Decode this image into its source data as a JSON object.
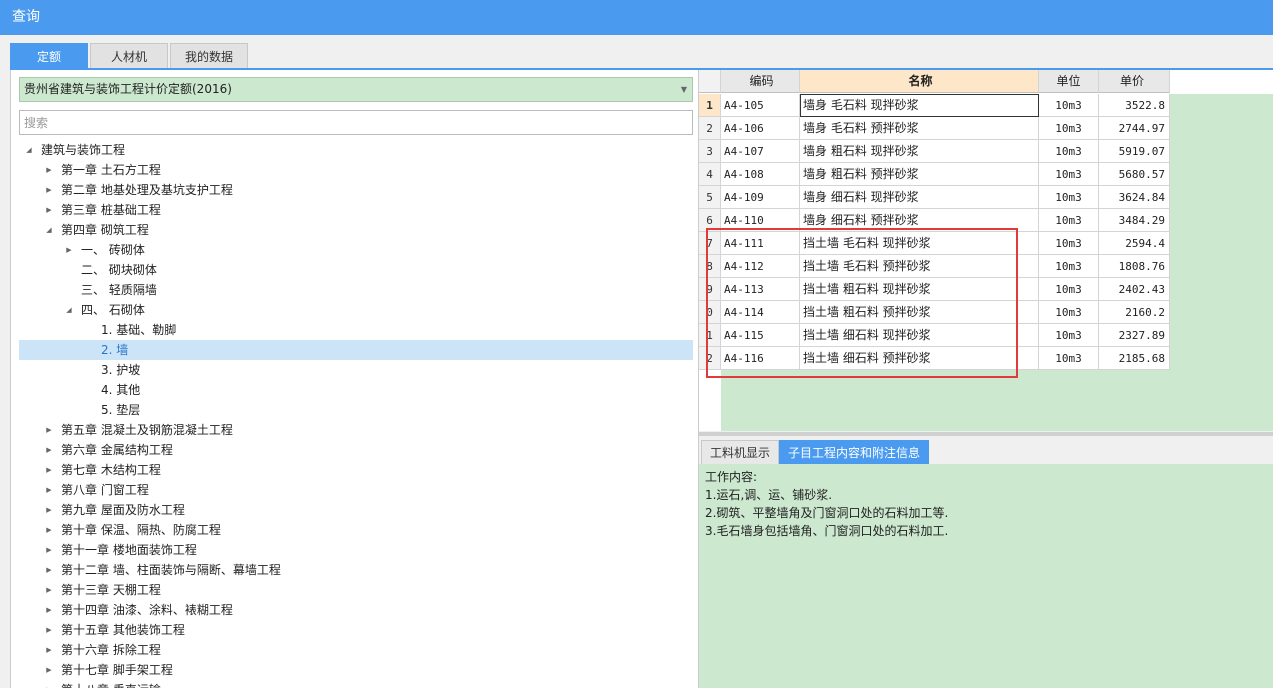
{
  "window": {
    "title": "查询"
  },
  "tabs": [
    {
      "label": "定额",
      "active": true
    },
    {
      "label": "人材机",
      "active": false
    },
    {
      "label": "我的数据",
      "active": false
    }
  ],
  "left": {
    "quota_select": "贵州省建筑与装饰工程计价定额(2016)",
    "search_placeholder": "搜索",
    "tree": [
      {
        "label": "建筑与装饰工程",
        "level": 0,
        "state": "expanded"
      },
      {
        "label": "第一章 土石方工程",
        "level": 1,
        "state": "collapsed"
      },
      {
        "label": "第二章 地基处理及基坑支护工程",
        "level": 1,
        "state": "collapsed"
      },
      {
        "label": "第三章 桩基础工程",
        "level": 1,
        "state": "collapsed"
      },
      {
        "label": "第四章 砌筑工程",
        "level": 1,
        "state": "expanded"
      },
      {
        "label": "一、 砖砌体",
        "level": 2,
        "state": "collapsed"
      },
      {
        "label": "二、 砌块砌体",
        "level": 2,
        "state": "leaf"
      },
      {
        "label": "三、 轻质隔墙",
        "level": 2,
        "state": "leaf"
      },
      {
        "label": "四、 石砌体",
        "level": 2,
        "state": "expanded"
      },
      {
        "label": "1. 基础、勒脚",
        "level": 3,
        "state": "leaf"
      },
      {
        "label": "2. 墙",
        "level": 3,
        "state": "leaf",
        "selected": true
      },
      {
        "label": "3. 护坡",
        "level": 3,
        "state": "leaf"
      },
      {
        "label": "4. 其他",
        "level": 3,
        "state": "leaf"
      },
      {
        "label": "5. 垫层",
        "level": 3,
        "state": "leaf"
      },
      {
        "label": "第五章 混凝土及钢筋混凝土工程",
        "level": 1,
        "state": "collapsed"
      },
      {
        "label": "第六章 金属结构工程",
        "level": 1,
        "state": "collapsed"
      },
      {
        "label": "第七章 木结构工程",
        "level": 1,
        "state": "collapsed"
      },
      {
        "label": "第八章 门窗工程",
        "level": 1,
        "state": "collapsed"
      },
      {
        "label": "第九章 屋面及防水工程",
        "level": 1,
        "state": "collapsed"
      },
      {
        "label": "第十章 保温、隔热、防腐工程",
        "level": 1,
        "state": "collapsed"
      },
      {
        "label": "第十一章 楼地面装饰工程",
        "level": 1,
        "state": "collapsed"
      },
      {
        "label": "第十二章 墙、柱面装饰与隔断、幕墙工程",
        "level": 1,
        "state": "collapsed"
      },
      {
        "label": "第十三章 天棚工程",
        "level": 1,
        "state": "collapsed"
      },
      {
        "label": "第十四章 油漆、涂料、裱糊工程",
        "level": 1,
        "state": "collapsed"
      },
      {
        "label": "第十五章 其他装饰工程",
        "level": 1,
        "state": "collapsed"
      },
      {
        "label": "第十六章 拆除工程",
        "level": 1,
        "state": "collapsed"
      },
      {
        "label": "第十七章 脚手架工程",
        "level": 1,
        "state": "collapsed"
      },
      {
        "label": "第十八章 垂直运输",
        "level": 1,
        "state": "collapsed"
      }
    ]
  },
  "grid": {
    "columns": [
      "编码",
      "名称",
      "单位",
      "单价"
    ],
    "rows": [
      {
        "idx": "1",
        "code": "A4-105",
        "name": "墙身 毛石料 现拌砂浆",
        "unit": "10m3",
        "price": "3522.8"
      },
      {
        "idx": "2",
        "code": "A4-106",
        "name": "墙身 毛石料 预拌砂浆",
        "unit": "10m3",
        "price": "2744.97"
      },
      {
        "idx": "3",
        "code": "A4-107",
        "name": "墙身 粗石料 现拌砂浆",
        "unit": "10m3",
        "price": "5919.07"
      },
      {
        "idx": "4",
        "code": "A4-108",
        "name": "墙身 粗石料 预拌砂浆",
        "unit": "10m3",
        "price": "5680.57"
      },
      {
        "idx": "5",
        "code": "A4-109",
        "name": "墙身 细石料 现拌砂浆",
        "unit": "10m3",
        "price": "3624.84"
      },
      {
        "idx": "6",
        "code": "A4-110",
        "name": "墙身 细石料 预拌砂浆",
        "unit": "10m3",
        "price": "3484.29"
      },
      {
        "idx": "7",
        "code": "A4-111",
        "name": "挡土墙 毛石料 现拌砂浆",
        "unit": "10m3",
        "price": "2594.4"
      },
      {
        "idx": "8",
        "code": "A4-112",
        "name": "挡土墙 毛石料 预拌砂浆",
        "unit": "10m3",
        "price": "1808.76"
      },
      {
        "idx": "9",
        "code": "A4-113",
        "name": "挡土墙 粗石料 现拌砂浆",
        "unit": "10m3",
        "price": "2402.43"
      },
      {
        "idx": "0",
        "code": "A4-114",
        "name": "挡土墙 粗石料 预拌砂浆",
        "unit": "10m3",
        "price": "2160.2"
      },
      {
        "idx": "1",
        "code": "A4-115",
        "name": "挡土墙 细石料 现拌砂浆",
        "unit": "10m3",
        "price": "2327.89"
      },
      {
        "idx": "2",
        "code": "A4-116",
        "name": "挡土墙 细石料 预拌砂浆",
        "unit": "10m3",
        "price": "2185.68"
      }
    ]
  },
  "lower": {
    "tabs": [
      {
        "label": "工料机显示",
        "active": false
      },
      {
        "label": "子目工程内容和附注信息",
        "active": true
      }
    ],
    "lines": [
      "工作内容:",
      "1.运石,调、运、铺砂浆.",
      "2.砌筑、平整墙角及门窗洞口处的石料加工等.",
      "3.毛石墙身包括墙角、门窗洞口处的石料加工."
    ]
  },
  "colors": {
    "accent": "#4a9bf0",
    "panel_green": "#cce8cf",
    "highlight_red": "#e03a3a"
  }
}
